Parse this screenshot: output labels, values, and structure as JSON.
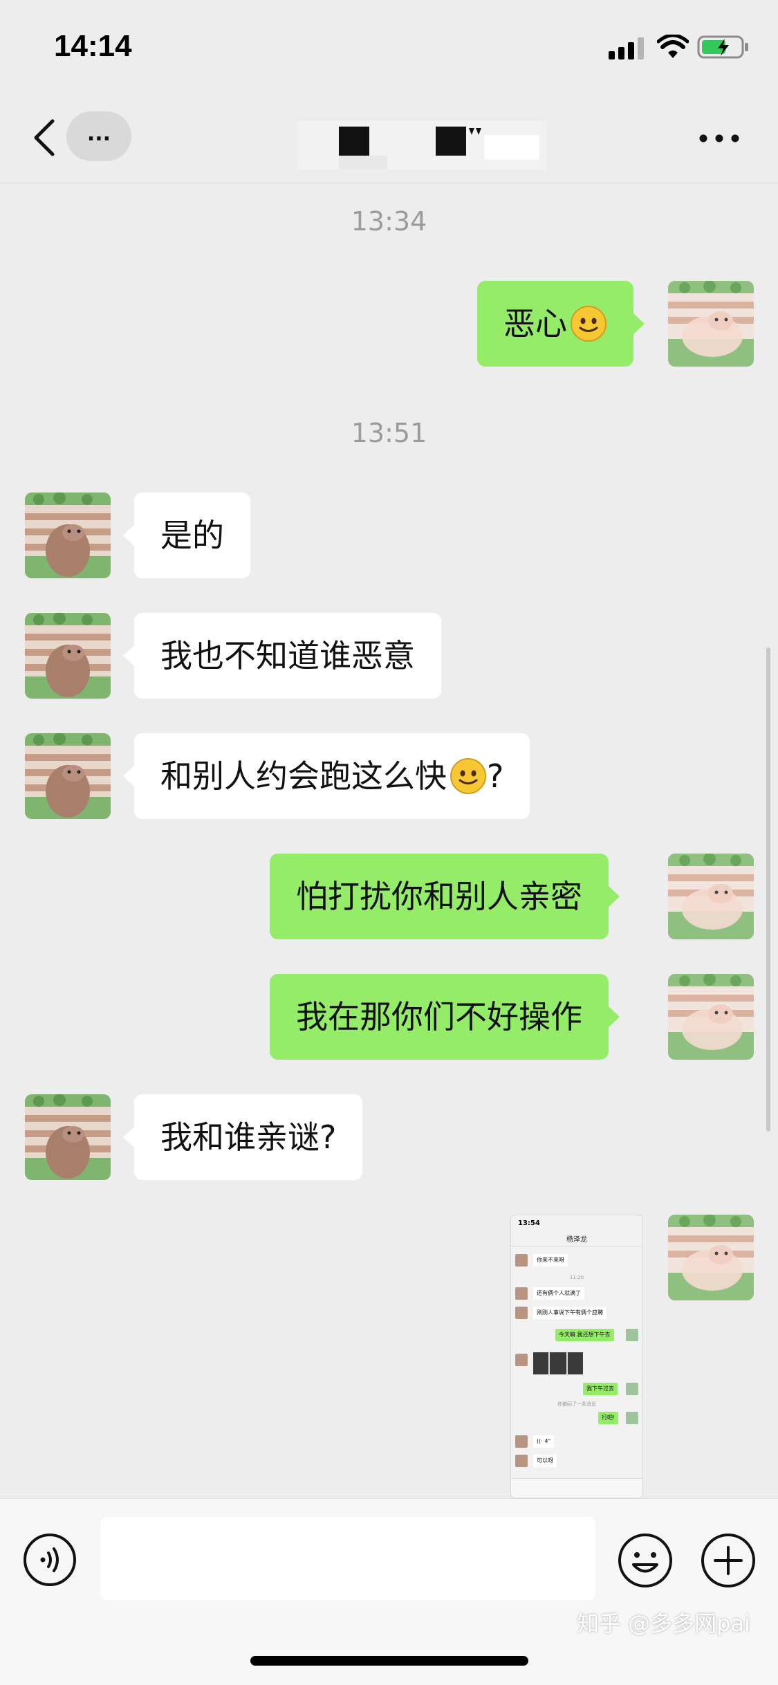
{
  "status_bar": {
    "time": "14:14",
    "icons": [
      "signal-icon",
      "wifi-icon",
      "battery-charging-icon"
    ]
  },
  "nav": {
    "back_icon": "chevron-left-icon",
    "unread_badge": "...",
    "more_icon": "ellipsis-icon"
  },
  "messages": [
    {
      "type": "time",
      "text": "13:34"
    },
    {
      "type": "out",
      "text": "恶心",
      "emoji": true
    },
    {
      "type": "time",
      "text": "13:51"
    },
    {
      "type": "in",
      "text": "是的"
    },
    {
      "type": "in",
      "text": "我也不知道谁恶意"
    },
    {
      "type": "in",
      "text": "和别人约会跑这么快",
      "emoji": true,
      "suffix": "?"
    },
    {
      "type": "out",
      "text": "怕打扰你和别人亲密"
    },
    {
      "type": "out",
      "text": "我在那你们不好操作"
    },
    {
      "type": "in",
      "text": "我和谁亲谜?"
    },
    {
      "type": "out-image",
      "description": "screenshot"
    }
  ],
  "thumbnail": {
    "status_time": "13:54",
    "title": "杨泽龙",
    "ts1": "11:20",
    "ts2": "你撤回了一条消息",
    "bubbles": [
      "你来不来呀",
      "还有俩个人就满了",
      "刚刚人事说下午有俩个应聘",
      "今天嘛 我还想下午去",
      "我下午过去",
      "行吧!",
      "((· 4\"",
      "可以呀"
    ]
  },
  "input_bar": {
    "voice_icon": "voice-icon",
    "emoji_icon": "smiley-icon",
    "plus_icon": "plus-circle-icon"
  },
  "watermark": "知乎 @多多网pai",
  "colors": {
    "background": "#ededed",
    "outgoing_bubble": "#95ec69",
    "incoming_bubble": "#ffffff",
    "timestamp": "#9b9b9b"
  }
}
